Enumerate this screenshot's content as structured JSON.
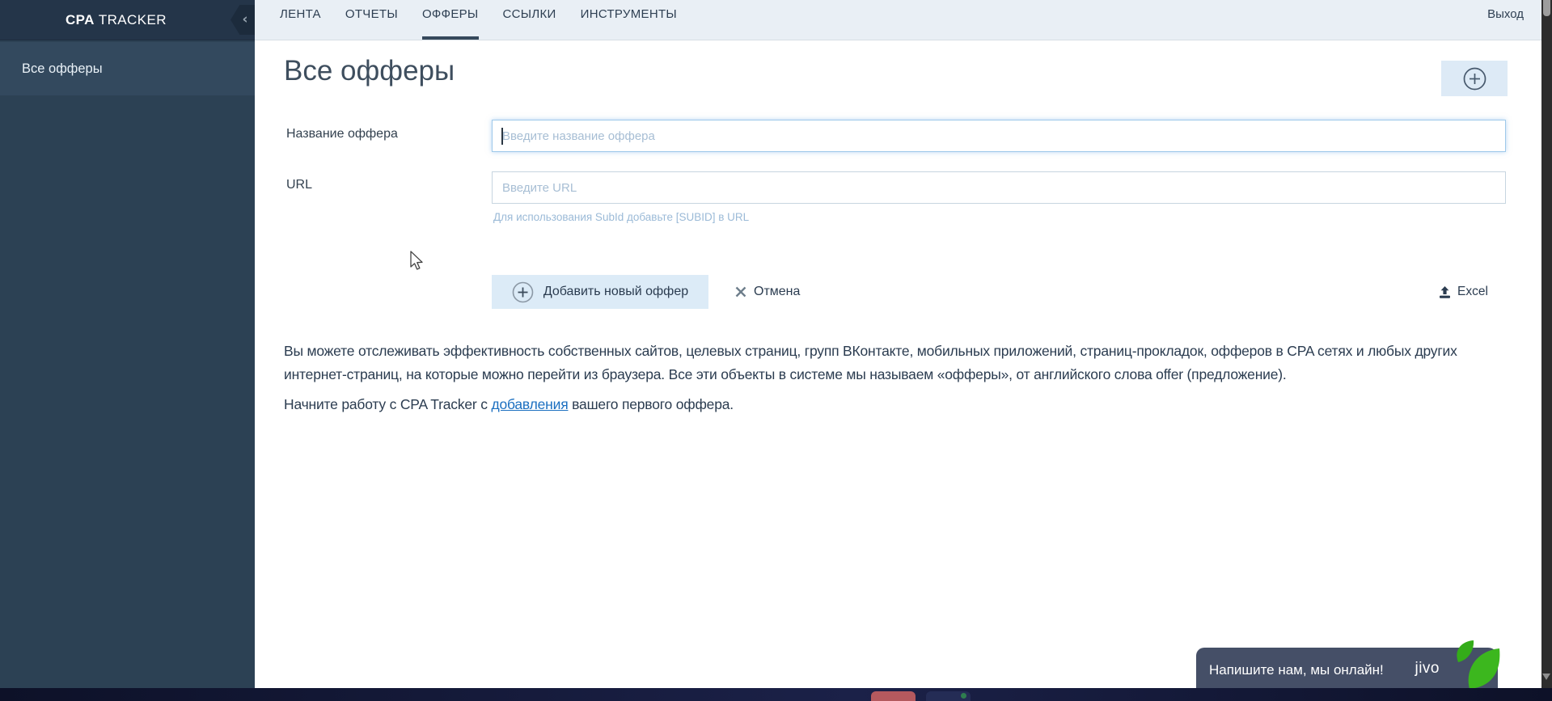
{
  "brand": {
    "bold": "CPA",
    "light": "TRACKER"
  },
  "topnav": {
    "items": [
      {
        "label": "ЛЕНТА"
      },
      {
        "label": "ОТЧЕТЫ"
      },
      {
        "label": "ОФФЕРЫ",
        "active": true
      },
      {
        "label": "ССЫЛКИ"
      },
      {
        "label": "ИНСТРУМЕНТЫ"
      }
    ],
    "logout_label": "Выход"
  },
  "sidebar": {
    "items": [
      {
        "label": "Все офферы",
        "selected": true
      }
    ]
  },
  "page": {
    "title": "Все офферы",
    "form": {
      "name_label": "Название оффера",
      "name_placeholder": "Введите название оффера",
      "name_value": "",
      "url_label": "URL",
      "url_placeholder": "Введите URL",
      "url_value": "",
      "url_hint": "Для использования SubId добавьте [SUBID] в URL",
      "submit_label": "Добавить новый оффер",
      "cancel_label": "Отмена",
      "excel_label": "Excel"
    },
    "intro_text": "Вы можете отслеживать эффективность собственных сайтов, целевых страниц, групп ВКонтакте, мобильных приложений, страниц-прокладок, офферов в CPA сетях и любых других интернет-страниц, на которые можно перейти из браузера. Все эти объекты в системе мы называем «офферы», от английского слова offer (предложение).",
    "start_text_prefix": "Начните работу с CPA Tracker с ",
    "start_link_label": "добавления",
    "start_text_suffix": " вашего первого оффера."
  },
  "chat": {
    "message": "Напишите нам, мы онлайн!",
    "brand": "jivo"
  },
  "icons": {
    "collapse": "sidebar-collapse-chevron",
    "plus": "circled-plus",
    "cancel": "x-cross",
    "excel": "upload-arrow",
    "leaf": "jivo-green-leaf"
  },
  "colors": {
    "sidebar": "#2c4154",
    "sidebar_selected": "#33495e",
    "sidebar_header": "#243549",
    "topbar": "#e9eff5",
    "nav_text": "#2e3f52",
    "button_bg": "#dcebf7",
    "focused_input_border": "#9ec9ea",
    "placeholder": "#a7bed4",
    "hint": "#9bbad7",
    "link": "#1b6fc0",
    "chat_bg": "#454f67",
    "chat_green": "#3cb71e",
    "scrollbar_track": "#2d2d2d"
  }
}
